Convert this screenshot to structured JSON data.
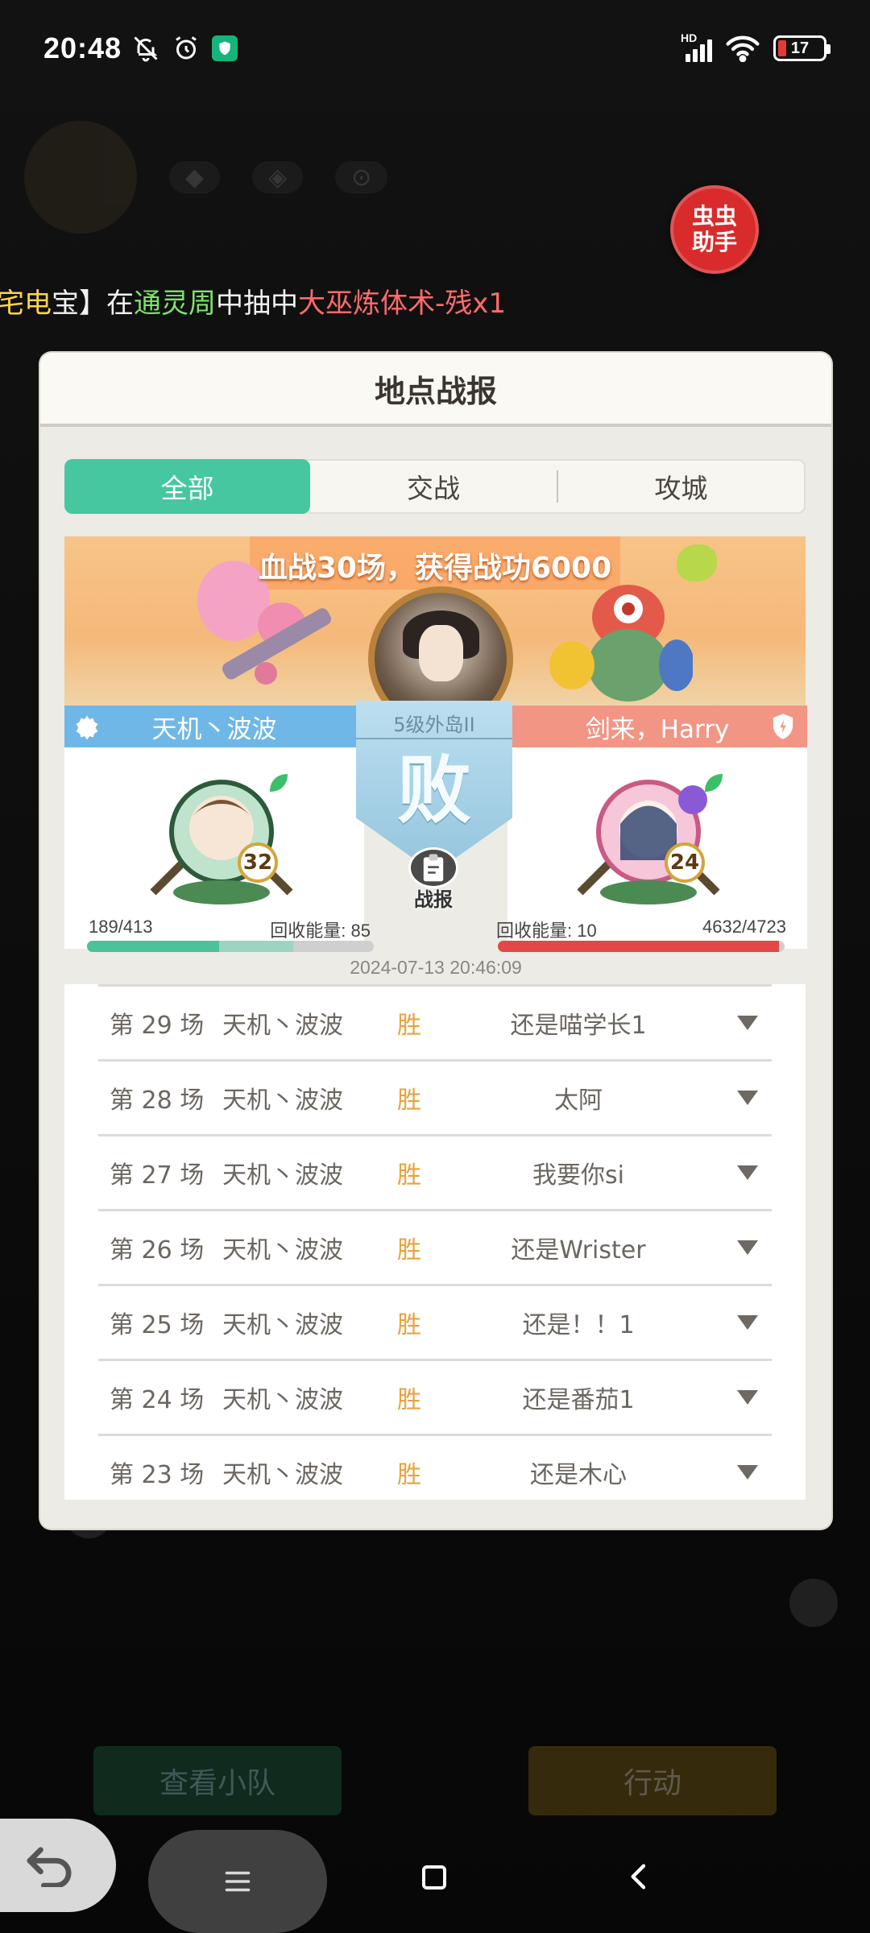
{
  "status_bar": {
    "time": "20:48",
    "battery": "17",
    "network": "HD"
  },
  "helper": {
    "line1": "虫虫",
    "line2": "助手"
  },
  "ticker": {
    "part1": "宝】在",
    "part2": "通灵周",
    "part3": "中抽中",
    "part4": "大巫炼体术-残x1",
    "prefix": "宅电"
  },
  "dialog": {
    "title": "地点战报",
    "tabs": [
      "全部",
      "交战",
      "攻城"
    ],
    "banner_title": "血战30场，获得战功6000",
    "left_player": {
      "name": "天机丶波波",
      "level": "32",
      "hp": "189/413",
      "recycle_label": "回收能量:",
      "recycle_value": "85"
    },
    "right_player": {
      "name": "剑来，Harry",
      "level": "24",
      "hp": "4632/4723",
      "recycle_label": "回收能量:",
      "recycle_value": "10"
    },
    "location": "5级外岛II",
    "result": "败",
    "report_label": "战报",
    "time": "2024-07-13 20:46:09",
    "battles": [
      {
        "round": "第 29 场",
        "attacker": "天机丶波波",
        "result": "胜",
        "defender": "还是喵学长1"
      },
      {
        "round": "第 28 场",
        "attacker": "天机丶波波",
        "result": "胜",
        "defender": "太阿"
      },
      {
        "round": "第 27 场",
        "attacker": "天机丶波波",
        "result": "胜",
        "defender": "我要你si"
      },
      {
        "round": "第 26 场",
        "attacker": "天机丶波波",
        "result": "胜",
        "defender": "还是Wrister"
      },
      {
        "round": "第 25 场",
        "attacker": "天机丶波波",
        "result": "胜",
        "defender": "还是！！1"
      },
      {
        "round": "第 24 场",
        "attacker": "天机丶波波",
        "result": "胜",
        "defender": "还是番茄1"
      },
      {
        "round": "第 23 场",
        "attacker": "天机丶波波",
        "result": "胜",
        "defender": "还是木心"
      }
    ],
    "hp_fraction_left": 0.46,
    "hp_fraction_right": 0.98
  },
  "background": {
    "left_button": "查看小队",
    "right_button": "行动"
  },
  "colors": {
    "tab_active": "#46c7a0",
    "win": "#e9a23b",
    "left_team": "#6fb7e6",
    "right_team": "#f29585"
  }
}
